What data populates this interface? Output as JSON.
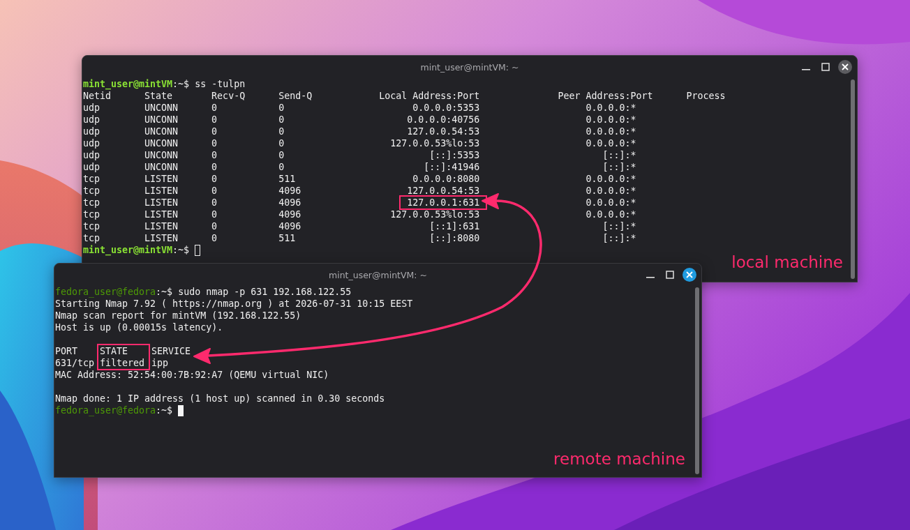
{
  "windows": [
    {
      "title": "mint_user@mintVM: ~",
      "focused": false,
      "annotation": "local machine",
      "session": [
        {
          "kind": "prompt",
          "color": "#8ae234",
          "bold": true,
          "user": "mint_user@mintVM",
          "suffix": ":~$",
          "command": "ss -tulpn"
        },
        {
          "kind": "socket_table",
          "columns": [
            "Netid",
            "State",
            "Recv-Q",
            "Send-Q",
            "Local Address:Port",
            "Peer Address:Port",
            "Process"
          ],
          "rows": [
            {
              "cells": [
                "udp",
                "UNCONN",
                "0",
                "0",
                "0.0.0.0:5353",
                "0.0.0.0:*"
              ],
              "highlighted": false
            },
            {
              "cells": [
                "udp",
                "UNCONN",
                "0",
                "0",
                "0.0.0.0:40756",
                "0.0.0.0:*"
              ],
              "highlighted": false
            },
            {
              "cells": [
                "udp",
                "UNCONN",
                "0",
                "0",
                "127.0.0.54:53",
                "0.0.0.0:*"
              ],
              "highlighted": false
            },
            {
              "cells": [
                "udp",
                "UNCONN",
                "0",
                "0",
                "127.0.0.53%lo:53",
                "0.0.0.0:*"
              ],
              "highlighted": false
            },
            {
              "cells": [
                "udp",
                "UNCONN",
                "0",
                "0",
                "[::]:5353",
                "[::]:*"
              ],
              "highlighted": false
            },
            {
              "cells": [
                "udp",
                "UNCONN",
                "0",
                "0",
                "[::]:41946",
                "[::]:*"
              ],
              "highlighted": false
            },
            {
              "cells": [
                "tcp",
                "LISTEN",
                "0",
                "511",
                "0.0.0.0:8080",
                "0.0.0.0:*"
              ],
              "highlighted": false
            },
            {
              "cells": [
                "tcp",
                "LISTEN",
                "0",
                "4096",
                "127.0.0.54:53",
                "0.0.0.0:*"
              ],
              "highlighted": false
            },
            {
              "cells": [
                "tcp",
                "LISTEN",
                "0",
                "4096",
                "127.0.0.1:631",
                "0.0.0.0:*"
              ],
              "highlighted": true
            },
            {
              "cells": [
                "tcp",
                "LISTEN",
                "0",
                "4096",
                "127.0.0.53%lo:53",
                "0.0.0.0:*"
              ],
              "highlighted": false
            },
            {
              "cells": [
                "tcp",
                "LISTEN",
                "0",
                "4096",
                "[::1]:631",
                "[::]:*"
              ],
              "highlighted": false
            },
            {
              "cells": [
                "tcp",
                "LISTEN",
                "0",
                "511",
                "[::]:8080",
                "[::]:*"
              ],
              "highlighted": false
            }
          ]
        },
        {
          "kind": "prompt",
          "color": "#8ae234",
          "bold": true,
          "user": "mint_user@mintVM",
          "suffix": ":~$",
          "cursor_filled": false
        }
      ]
    },
    {
      "title": "mint_user@mintVM: ~",
      "focused": true,
      "annotation": "remote machine",
      "session": [
        {
          "kind": "prompt",
          "color": "#4e9a06",
          "bold": false,
          "user": "fedora_user@fedora",
          "suffix": ":~$",
          "command": "sudo nmap -p 631 192.168.122.55"
        },
        {
          "kind": "text",
          "text": "Starting Nmap 7.92 ( https://nmap.org ) at 2026-07-31 10:15 EEST"
        },
        {
          "kind": "text",
          "text": "Nmap scan report for mintVM (192.168.122.55)"
        },
        {
          "kind": "text",
          "text": "Host is up (0.00015s latency)."
        },
        {
          "kind": "blank"
        },
        {
          "kind": "port_table",
          "columns": [
            {
              "label": "PORT",
              "highlighted": false
            },
            {
              "label": "STATE",
              "highlighted": true
            },
            {
              "label": "SERVICE",
              "highlighted": false
            }
          ],
          "rows": [
            [
              "631/tcp",
              "filtered",
              "ipp"
            ]
          ]
        },
        {
          "kind": "text",
          "text": "MAC Address: 52:54:00:7B:92:A7 (QEMU virtual NIC)"
        },
        {
          "kind": "blank"
        },
        {
          "kind": "text",
          "text": "Nmap done: 1 IP address (1 host up) scanned in 0.30 seconds"
        },
        {
          "kind": "prompt",
          "color": "#4e9a06",
          "bold": false,
          "user": "fedora_user@fedora",
          "suffix": ":~$",
          "cursor_filled": true
        }
      ]
    }
  ]
}
